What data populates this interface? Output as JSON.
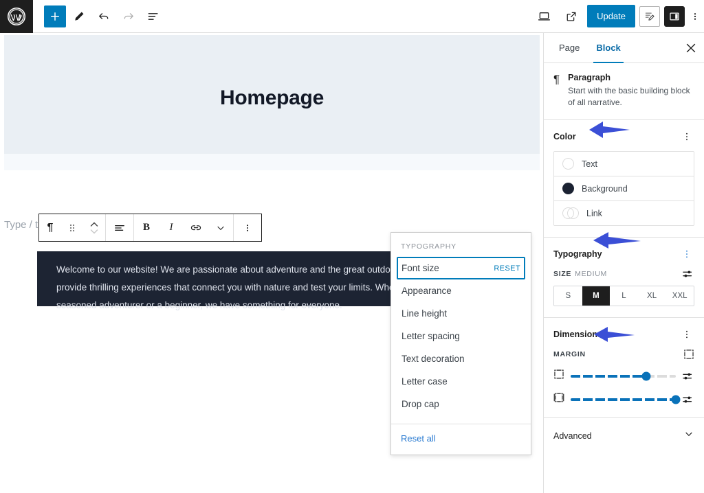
{
  "topbar": {
    "logo_icon": "wordpress-logo-icon",
    "left_tools": [
      {
        "name": "add-block-button",
        "icon": "plus-icon",
        "label": "+"
      },
      {
        "name": "edit-mode-button",
        "icon": "pencil-icon",
        "label": ""
      },
      {
        "name": "undo-button",
        "icon": "undo-arrow-icon",
        "label": ""
      },
      {
        "name": "redo-button",
        "icon": "redo-arrow-icon",
        "label": ""
      },
      {
        "name": "document-overview-button",
        "icon": "list-view-icon",
        "label": ""
      }
    ],
    "right_tools": [
      {
        "name": "view-device-button",
        "icon": "laptop-icon",
        "label": ""
      },
      {
        "name": "view-site-button",
        "icon": "external-link-icon",
        "label": ""
      }
    ],
    "update_label": "Update",
    "settings_icon": "pencil-square-icon",
    "sidebar_toggle_icon": "sidebar-panel-icon",
    "more_options_icon": "vertical-dots-icon"
  },
  "canvas": {
    "hero_title": "Homepage",
    "placeholder": "Type / t",
    "block_toolbar": {
      "groups": [
        [
          {
            "name": "block-type-paragraph-button",
            "icon": "pilcrow-icon",
            "label": "¶"
          },
          {
            "name": "drag-handle-button",
            "icon": "drag-dots-icon",
            "label": ""
          },
          {
            "name": "move-up-down-button",
            "icon": "chevron-up-down-icon",
            "label": ""
          }
        ],
        [
          {
            "name": "align-text-button",
            "icon": "align-left-icon",
            "label": ""
          }
        ],
        [
          {
            "name": "bold-button",
            "icon": "bold-icon",
            "label": "B"
          },
          {
            "name": "italic-button",
            "icon": "italic-icon",
            "label": "I"
          },
          {
            "name": "link-button",
            "icon": "link-icon",
            "label": ""
          },
          {
            "name": "more-rich-text-button",
            "icon": "chevron-down-icon",
            "label": ""
          }
        ],
        [
          {
            "name": "block-options-button",
            "icon": "vertical-dots-icon",
            "label": ""
          }
        ]
      ]
    },
    "paragraph_text": "Welcome to our website! We are passionate about adventure and the great outdoors. Our mission is to provide thrilling experiences that connect you with nature and test your limits. Whether you're a seasoned adventurer or a beginner, we have something for everyone."
  },
  "typography_popover": {
    "heading": "TYPOGRAPHY",
    "items": [
      {
        "label": "Font size",
        "reset": "RESET",
        "focused": true
      },
      {
        "label": "Appearance",
        "reset": "",
        "focused": false
      },
      {
        "label": "Line height",
        "reset": "",
        "focused": false
      },
      {
        "label": "Letter spacing",
        "reset": "",
        "focused": false
      },
      {
        "label": "Text decoration",
        "reset": "",
        "focused": false
      },
      {
        "label": "Letter case",
        "reset": "",
        "focused": false
      },
      {
        "label": "Drop cap",
        "reset": "",
        "focused": false
      }
    ],
    "reset_all": "Reset all"
  },
  "sidebar": {
    "tabs": [
      {
        "label": "Page",
        "active": false
      },
      {
        "label": "Block",
        "active": true
      }
    ],
    "close_icon": "close-icon",
    "block_card": {
      "icon": "pilcrow-icon",
      "icon_glyph": "¶",
      "name": "Paragraph",
      "description": "Start with the basic building block of all narrative."
    },
    "color_panel": {
      "title": "Color",
      "options_icon": "vertical-dots-icon",
      "rows": [
        {
          "label": "Text",
          "swatch": "empty",
          "color": ""
        },
        {
          "label": "Background",
          "swatch": "solid",
          "color": "#1b2232"
        },
        {
          "label": "Link",
          "swatch": "duotone",
          "color": ""
        }
      ]
    },
    "typography_panel": {
      "title": "Typography",
      "options_icon": "vertical-dots-icon",
      "size_label": "SIZE",
      "size_value": "MEDIUM",
      "size_tool_icon": "settings-sliders-icon",
      "sizes": [
        {
          "label": "S",
          "active": false
        },
        {
          "label": "M",
          "active": true
        },
        {
          "label": "L",
          "active": false
        },
        {
          "label": "XL",
          "active": false
        },
        {
          "label": "XXL",
          "active": false
        }
      ]
    },
    "dimensions_panel": {
      "title": "Dimensions",
      "options_icon": "vertical-dots-icon",
      "margin_label": "MARGIN",
      "margin_tool_icon": "margin-all-sides-icon",
      "sliders": [
        {
          "name": "margin-top-slider",
          "icon": "margin-vertical-icon",
          "percent": 72
        },
        {
          "name": "margin-bottom-slider",
          "icon": "margin-horizontal-icon",
          "percent": 100
        }
      ],
      "slider_tool_icon": "settings-sliders-icon"
    },
    "advanced_panel": {
      "title": "Advanced",
      "chevron_icon": "chevron-down-icon"
    }
  },
  "annotations": {
    "arrow_color": "#3b4fd6",
    "arrows": [
      {
        "name": "arrow-to-color-panel"
      },
      {
        "name": "arrow-to-typography-panel"
      },
      {
        "name": "arrow-to-margin-label"
      }
    ]
  }
}
